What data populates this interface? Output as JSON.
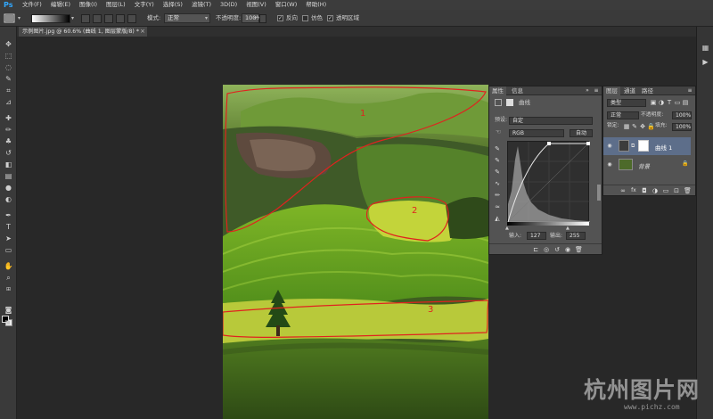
{
  "app": {
    "logo": "Ps"
  },
  "menu": [
    "文件(F)",
    "编辑(E)",
    "图像(I)",
    "图层(L)",
    "文字(Y)",
    "选择(S)",
    "滤镜(T)",
    "3D(D)",
    "视图(V)",
    "窗口(W)",
    "帮助(H)"
  ],
  "options": {
    "mode_label": "模式:",
    "mode_value": "正常",
    "opacity_label": "不透明度:",
    "opacity_value": "100%",
    "reverse_label": "反向",
    "dither_label": "仿色",
    "transparency_label": "透明区域"
  },
  "document": {
    "tab_title": "示例图片.jpg @ 60.6% (曲线 1, 图层蒙版/8) *",
    "close": "×"
  },
  "properties": {
    "tab_properties": "属性",
    "tab_info": "信息",
    "adjustment_title": "曲线",
    "preset_label": "预设:",
    "preset_value": "自定",
    "channel_value": "RGB",
    "auto_button": "自动",
    "input_label": "输入:",
    "input_value": "127",
    "output_label": "输出:",
    "output_value": "255"
  },
  "layers": {
    "tab_layers": "图层",
    "tab_channels": "通道",
    "tab_paths": "路径",
    "filter_value": "类型",
    "blend_value": "正常",
    "opacity_label": "不透明度:",
    "opacity_value": "100%",
    "lock_label": "锁定:",
    "fill_label": "填充:",
    "fill_value": "100%",
    "items": [
      {
        "name": "曲线 1"
      },
      {
        "name": "背景"
      }
    ]
  },
  "annotations": [
    "1",
    "2",
    "3"
  ],
  "watermark": {
    "title": "杭州图片网",
    "url": "www.pichz.com"
  },
  "colors": {
    "annotation_red": "#e0221f",
    "panel_bg": "#535353",
    "selected_layer": "#5d6e8a",
    "accent_ps": "#31a8ff"
  }
}
